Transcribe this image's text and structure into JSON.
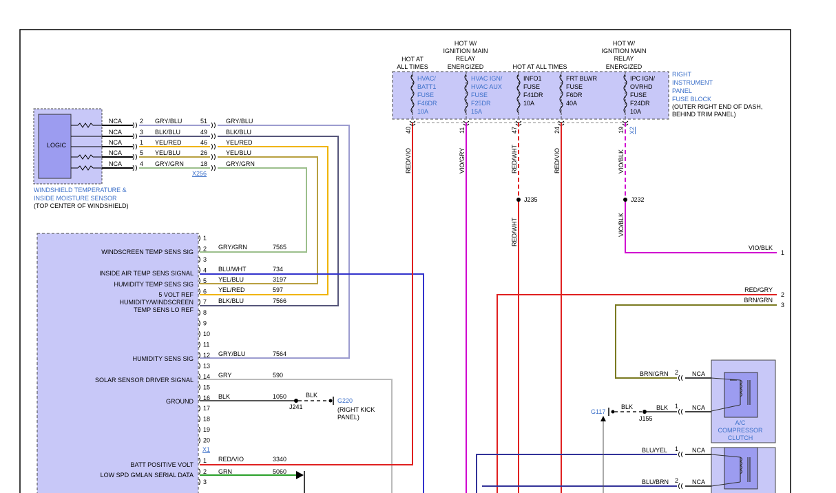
{
  "sensor": {
    "logic_label": "LOGIC",
    "caption": [
      "WINDSHIELD TEMPERATURE &",
      "INSIDE MOISTURE SENSOR"
    ],
    "location": "(TOP CENTER OF WINDSHIELD)",
    "connector": "X256",
    "rows": [
      {
        "nca": "NCA",
        "pin": "2",
        "color_code": "GRY/BLU",
        "cavity": "51",
        "color_code2": "GRY/BLU",
        "wire_color": "#9c9ccf"
      },
      {
        "nca": "NCA",
        "pin": "3",
        "color_code": "BLK/BLU",
        "cavity": "49",
        "color_code2": "BLK/BLU",
        "wire_color": "#55557a"
      },
      {
        "nca": "NCA",
        "pin": "1",
        "color_code": "YEL/RED",
        "cavity": "46",
        "color_code2": "YEL/RED",
        "wire_color": "#f0b400"
      },
      {
        "nca": "NCA",
        "pin": "5",
        "color_code": "YEL/BLU",
        "cavity": "26",
        "color_code2": "YEL/BLU",
        "wire_color": "#b8a040"
      },
      {
        "nca": "NCA",
        "pin": "4",
        "color_code": "GRY/GRN",
        "cavity": "18",
        "color_code2": "GRY/GRN",
        "wire_color": "#9cbf8c"
      }
    ]
  },
  "module": {
    "connector_x1": "X1",
    "pins": [
      "1",
      "2",
      "3",
      "4",
      "5",
      "6",
      "7",
      "8",
      "9",
      "10",
      "11",
      "12",
      "13",
      "14",
      "15",
      "16",
      "17",
      "18",
      "19",
      "20"
    ],
    "pins_lower": [
      "1",
      "2",
      "3"
    ],
    "labels": [
      {
        "text": "WINDSCREEN TEMP SENS SIG"
      },
      {
        "text": "INSIDE AIR TEMP SENS SIGNAL"
      },
      {
        "text": "HUMIDITY TEMP SENS SIG"
      },
      {
        "text": "5 VOLT REF"
      },
      {
        "text": "HUMIDITY/WINDSCREEN"
      },
      {
        "text": "TEMP SENS LO REF"
      },
      {
        "text": "HUMIDITY SENS SIG"
      },
      {
        "text": "SOLAR SENSOR DRIVER SIGNAL"
      },
      {
        "text": "GROUND"
      },
      {
        "text": "BATT POSITIVE VOLT"
      },
      {
        "text": "LOW SPD GMLAN SERIAL DATA"
      }
    ],
    "wires": [
      {
        "pin": "2",
        "color_code": "GRY/GRN",
        "circuit": "7565",
        "wire_color": "#9cbf8c"
      },
      {
        "pin": "4",
        "color_code": "BLU/WHT",
        "circuit": "734",
        "wire_color": "#3333cc"
      },
      {
        "pin": "5",
        "color_code": "YEL/BLU",
        "circuit": "3197",
        "wire_color": "#b8a040"
      },
      {
        "pin": "6",
        "color_code": "YEL/RED",
        "circuit": "597",
        "wire_color": "#f0b400"
      },
      {
        "pin": "7",
        "color_code": "BLK/BLU",
        "circuit": "7566",
        "wire_color": "#55557a"
      },
      {
        "pin": "12",
        "color_code": "GRY/BLU",
        "circuit": "7564",
        "wire_color": "#9c9ccf"
      },
      {
        "pin": "14",
        "color_code": "GRY",
        "circuit": "590",
        "wire_color": "#bbbbbb"
      },
      {
        "pin": "16",
        "color_code": "BLK",
        "circuit": "1050",
        "wire_color": "#555555"
      },
      {
        "pin": "1",
        "color_code": "RED/VIO",
        "circuit": "3340",
        "wire_color": "#e02020"
      },
      {
        "pin": "2",
        "color_code": "GRN",
        "circuit": "5060",
        "wire_color": "#2aa02a"
      }
    ]
  },
  "ground_g220": {
    "splice": "J241",
    "color_code": "BLK",
    "name": "G220",
    "note": [
      "(RIGHT KICK",
      "PANEL)"
    ]
  },
  "fuse_block": {
    "title": [
      "RIGHT",
      "INSTRUMENT",
      "PANEL",
      "FUSE BLOCK"
    ],
    "location": [
      "(OUTER RIGHT END OF DASH,",
      "BEHIND TRIM PANEL)"
    ],
    "headers": [
      {
        "lines": [
          "HOT AT",
          "ALL TIMES"
        ]
      },
      {
        "lines": [
          "HOT W/",
          "IGNITION MAIN",
          "RELAY",
          "ENERGIZED"
        ]
      },
      {
        "lines": [
          "HOT AT ALL TIMES"
        ]
      },
      {
        "lines": [
          "HOT W/",
          "IGNITION MAIN",
          "RELAY",
          "ENERGIZED"
        ]
      }
    ],
    "fuses": [
      {
        "lines": [
          "HVAC/",
          "BATT1",
          "FUSE",
          "F46DR",
          "10A"
        ],
        "blue": true,
        "cavity": "40",
        "wire": "RED/VIO",
        "wire_color": "#e02020"
      },
      {
        "lines": [
          "HVAC IGN/",
          "HVAC AUX",
          "FUSE",
          "F25DR",
          "15A"
        ],
        "blue": true,
        "cavity": "11",
        "wire": "VIO/GRY",
        "wire_color": "#d000d0"
      },
      {
        "lines": [
          "INFO1",
          "FUSE",
          "F41DR",
          "10A"
        ],
        "blue": false,
        "cavity": "47",
        "wire": "RED/WHT",
        "wire_color": "#e02020"
      },
      {
        "lines": [
          "FRT BLWR",
          "FUSE",
          "F6DR",
          "40A"
        ],
        "blue": false,
        "cavity": "24",
        "wire": "RED/VIO",
        "wire_color": "#e02020"
      },
      {
        "lines": [
          "IPC IGN/",
          "OVRHD",
          "FUSE",
          "F24DR",
          "10A"
        ],
        "blue": false,
        "cavity": "19",
        "wire": "VIO/BLK",
        "wire_color": "#d000d0"
      }
    ],
    "connector_x2": "X2"
  },
  "splices": {
    "j235": "J235",
    "j232": "J232",
    "red_wht_lower": "RED/WHT",
    "vio_blk_lower": "VIO/BLK"
  },
  "right_side": {
    "wires": [
      {
        "label": "VIO/BLK",
        "num": "1"
      },
      {
        "label": "RED/GRY",
        "num": "2"
      },
      {
        "label": "BRN/GRN",
        "num": "3"
      }
    ]
  },
  "compressor": {
    "caption": [
      "A/C",
      "COMPRESSOR",
      "CLUTCH"
    ],
    "rows": [
      {
        "color_code": "BRN/GRN",
        "pin": "2",
        "nca": "NCA"
      },
      {
        "color_code": "BLK",
        "pin": "1",
        "nca": "NCA"
      }
    ],
    "ground": {
      "name": "G117",
      "color_code": "BLK",
      "splice": "J155"
    }
  },
  "lower_device": {
    "rows": [
      {
        "color_code": "BLU/YEL",
        "pin": "1",
        "nca": "NCA"
      },
      {
        "color_code": "BLU/BRN",
        "pin": "2",
        "nca": "NCA"
      }
    ]
  }
}
